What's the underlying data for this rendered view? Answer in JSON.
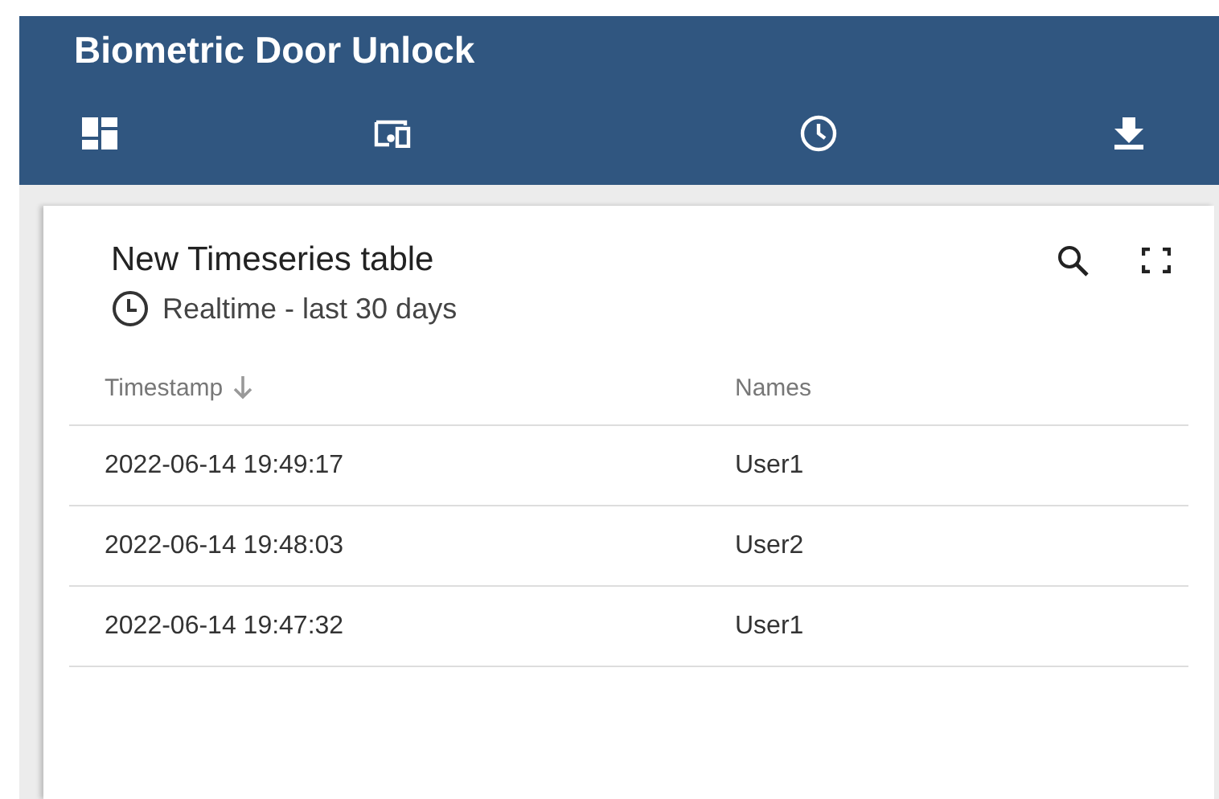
{
  "app_bar": {
    "title": "Biometric Door Unlock"
  },
  "card": {
    "title": "New Timeseries table",
    "timewindow": "Realtime - last 30 days",
    "table": {
      "columns": [
        {
          "label": "Timestamp",
          "sorted": true
        },
        {
          "label": "Names",
          "sorted": false
        }
      ],
      "rows": [
        [
          "2022-06-14 19:49:17",
          "User1"
        ],
        [
          "2022-06-14 19:48:03",
          "User2"
        ],
        [
          "2022-06-14 19:47:32",
          "User1"
        ]
      ]
    }
  }
}
